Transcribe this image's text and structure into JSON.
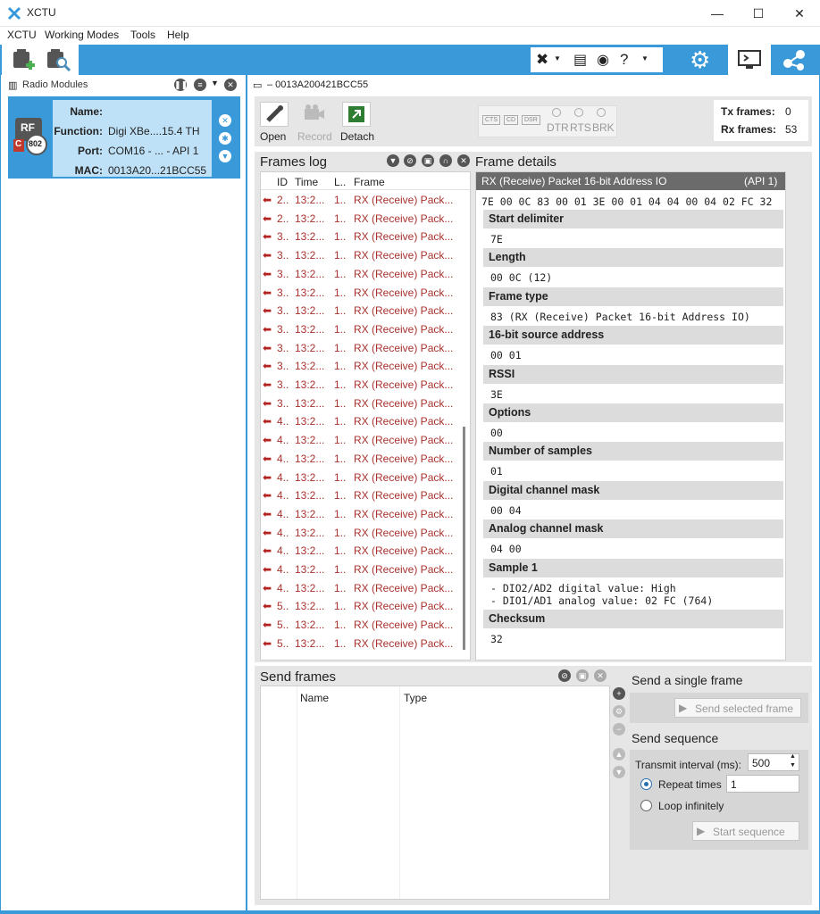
{
  "app": {
    "title": "XCTU"
  },
  "menu": [
    "XCTU",
    "Working Modes",
    "Tools",
    "Help"
  ],
  "window_controls": {
    "minimize": "—",
    "maximize": "☐",
    "close": "✕"
  },
  "left": {
    "header": "Radio Modules",
    "module": {
      "name_label": "Name:",
      "name_value": "",
      "function_label": "Function:",
      "function_value": "Digi XBe....15.4 TH",
      "port_label": "Port:",
      "port_value": "COM16 - ... - API 1",
      "mac_label": "MAC:",
      "mac_value": "0013A20...21BCC55",
      "icon_text": "RF",
      "badge_text": "802",
      "c_text": "C"
    }
  },
  "console": {
    "tab_title": "– 0013A200421BCC55",
    "open_label": "Open",
    "record_label": "Record",
    "detach_label": "Detach",
    "signals": [
      "CTS",
      "CD",
      "DSR"
    ],
    "lines": [
      "DTR",
      "RTS",
      "BRK"
    ],
    "tx_label": "Tx frames:",
    "tx_value": "0",
    "rx_label": "Rx frames:",
    "rx_value": "53"
  },
  "frames_log": {
    "title": "Frames log",
    "columns": [
      "ID",
      "Time",
      "L..",
      "Frame"
    ],
    "rows": [
      {
        "id": "2..",
        "time": "13:2...",
        "len": "1..",
        "frame": "RX (Receive) Pack..."
      },
      {
        "id": "2..",
        "time": "13:2...",
        "len": "1..",
        "frame": "RX (Receive) Pack..."
      },
      {
        "id": "3..",
        "time": "13:2...",
        "len": "1..",
        "frame": "RX (Receive) Pack..."
      },
      {
        "id": "3..",
        "time": "13:2...",
        "len": "1..",
        "frame": "RX (Receive) Pack..."
      },
      {
        "id": "3..",
        "time": "13:2...",
        "len": "1..",
        "frame": "RX (Receive) Pack..."
      },
      {
        "id": "3..",
        "time": "13:2...",
        "len": "1..",
        "frame": "RX (Receive) Pack..."
      },
      {
        "id": "3..",
        "time": "13:2...",
        "len": "1..",
        "frame": "RX (Receive) Pack..."
      },
      {
        "id": "3..",
        "time": "13:2...",
        "len": "1..",
        "frame": "RX (Receive) Pack..."
      },
      {
        "id": "3..",
        "time": "13:2...",
        "len": "1..",
        "frame": "RX (Receive) Pack..."
      },
      {
        "id": "3..",
        "time": "13:2...",
        "len": "1..",
        "frame": "RX (Receive) Pack..."
      },
      {
        "id": "3..",
        "time": "13:2...",
        "len": "1..",
        "frame": "RX (Receive) Pack..."
      },
      {
        "id": "3..",
        "time": "13:2...",
        "len": "1..",
        "frame": "RX (Receive) Pack..."
      },
      {
        "id": "4..",
        "time": "13:2...",
        "len": "1..",
        "frame": "RX (Receive) Pack..."
      },
      {
        "id": "4..",
        "time": "13:2...",
        "len": "1..",
        "frame": "RX (Receive) Pack..."
      },
      {
        "id": "4..",
        "time": "13:2...",
        "len": "1..",
        "frame": "RX (Receive) Pack..."
      },
      {
        "id": "4..",
        "time": "13:2...",
        "len": "1..",
        "frame": "RX (Receive) Pack..."
      },
      {
        "id": "4..",
        "time": "13:2...",
        "len": "1..",
        "frame": "RX (Receive) Pack..."
      },
      {
        "id": "4..",
        "time": "13:2...",
        "len": "1..",
        "frame": "RX (Receive) Pack..."
      },
      {
        "id": "4..",
        "time": "13:2...",
        "len": "1..",
        "frame": "RX (Receive) Pack..."
      },
      {
        "id": "4..",
        "time": "13:2...",
        "len": "1..",
        "frame": "RX (Receive) Pack..."
      },
      {
        "id": "4..",
        "time": "13:2...",
        "len": "1..",
        "frame": "RX (Receive) Pack..."
      },
      {
        "id": "4..",
        "time": "13:2...",
        "len": "1..",
        "frame": "RX (Receive) Pack..."
      },
      {
        "id": "5..",
        "time": "13:2...",
        "len": "1..",
        "frame": "RX (Receive) Pack..."
      },
      {
        "id": "5..",
        "time": "13:2...",
        "len": "1..",
        "frame": "RX (Receive) Pack..."
      },
      {
        "id": "5..",
        "time": "13:2...",
        "len": "1..",
        "frame": "RX (Receive) Pack..."
      }
    ]
  },
  "frame_details": {
    "title": "Frame details",
    "frame_name": "RX (Receive) Packet 16-bit Address IO",
    "api": "(API 1)",
    "hex": "7E 00 0C 83 00 01 3E 00 01 04 04 00 04 02 FC 32",
    "sections": [
      {
        "label": "Start delimiter",
        "value": "7E"
      },
      {
        "label": "Length",
        "value": "00 0C (12)"
      },
      {
        "label": "Frame type",
        "value": "83 (RX (Receive) Packet 16-bit Address IO)"
      },
      {
        "label": "16-bit source address",
        "value": "00 01"
      },
      {
        "label": "RSSI",
        "value": "3E"
      },
      {
        "label": "Options",
        "value": "00"
      },
      {
        "label": "Number of samples",
        "value": "01"
      },
      {
        "label": "Digital channel mask",
        "value": "00 04"
      },
      {
        "label": "Analog channel mask",
        "value": "04 00"
      },
      {
        "label": "Sample 1",
        "value": " - DIO2/AD2 digital value: High",
        "value2": " - DIO1/AD1 analog value: 02 FC (764)"
      },
      {
        "label": "Checksum",
        "value": "32"
      }
    ]
  },
  "send_frames": {
    "title": "Send frames",
    "columns": [
      "Name",
      "Type"
    ],
    "single_title": "Send a single frame",
    "send_selected": "Send selected frame",
    "sequence_title": "Send sequence",
    "interval_label": "Transmit interval (ms):",
    "interval_value": "500",
    "repeat_label": "Repeat times",
    "repeat_value": "1",
    "loop_label": "Loop infinitely",
    "start_label": "Start sequence"
  },
  "colors": {
    "accent": "#3a9ad9",
    "arrow": "#b3221e"
  }
}
